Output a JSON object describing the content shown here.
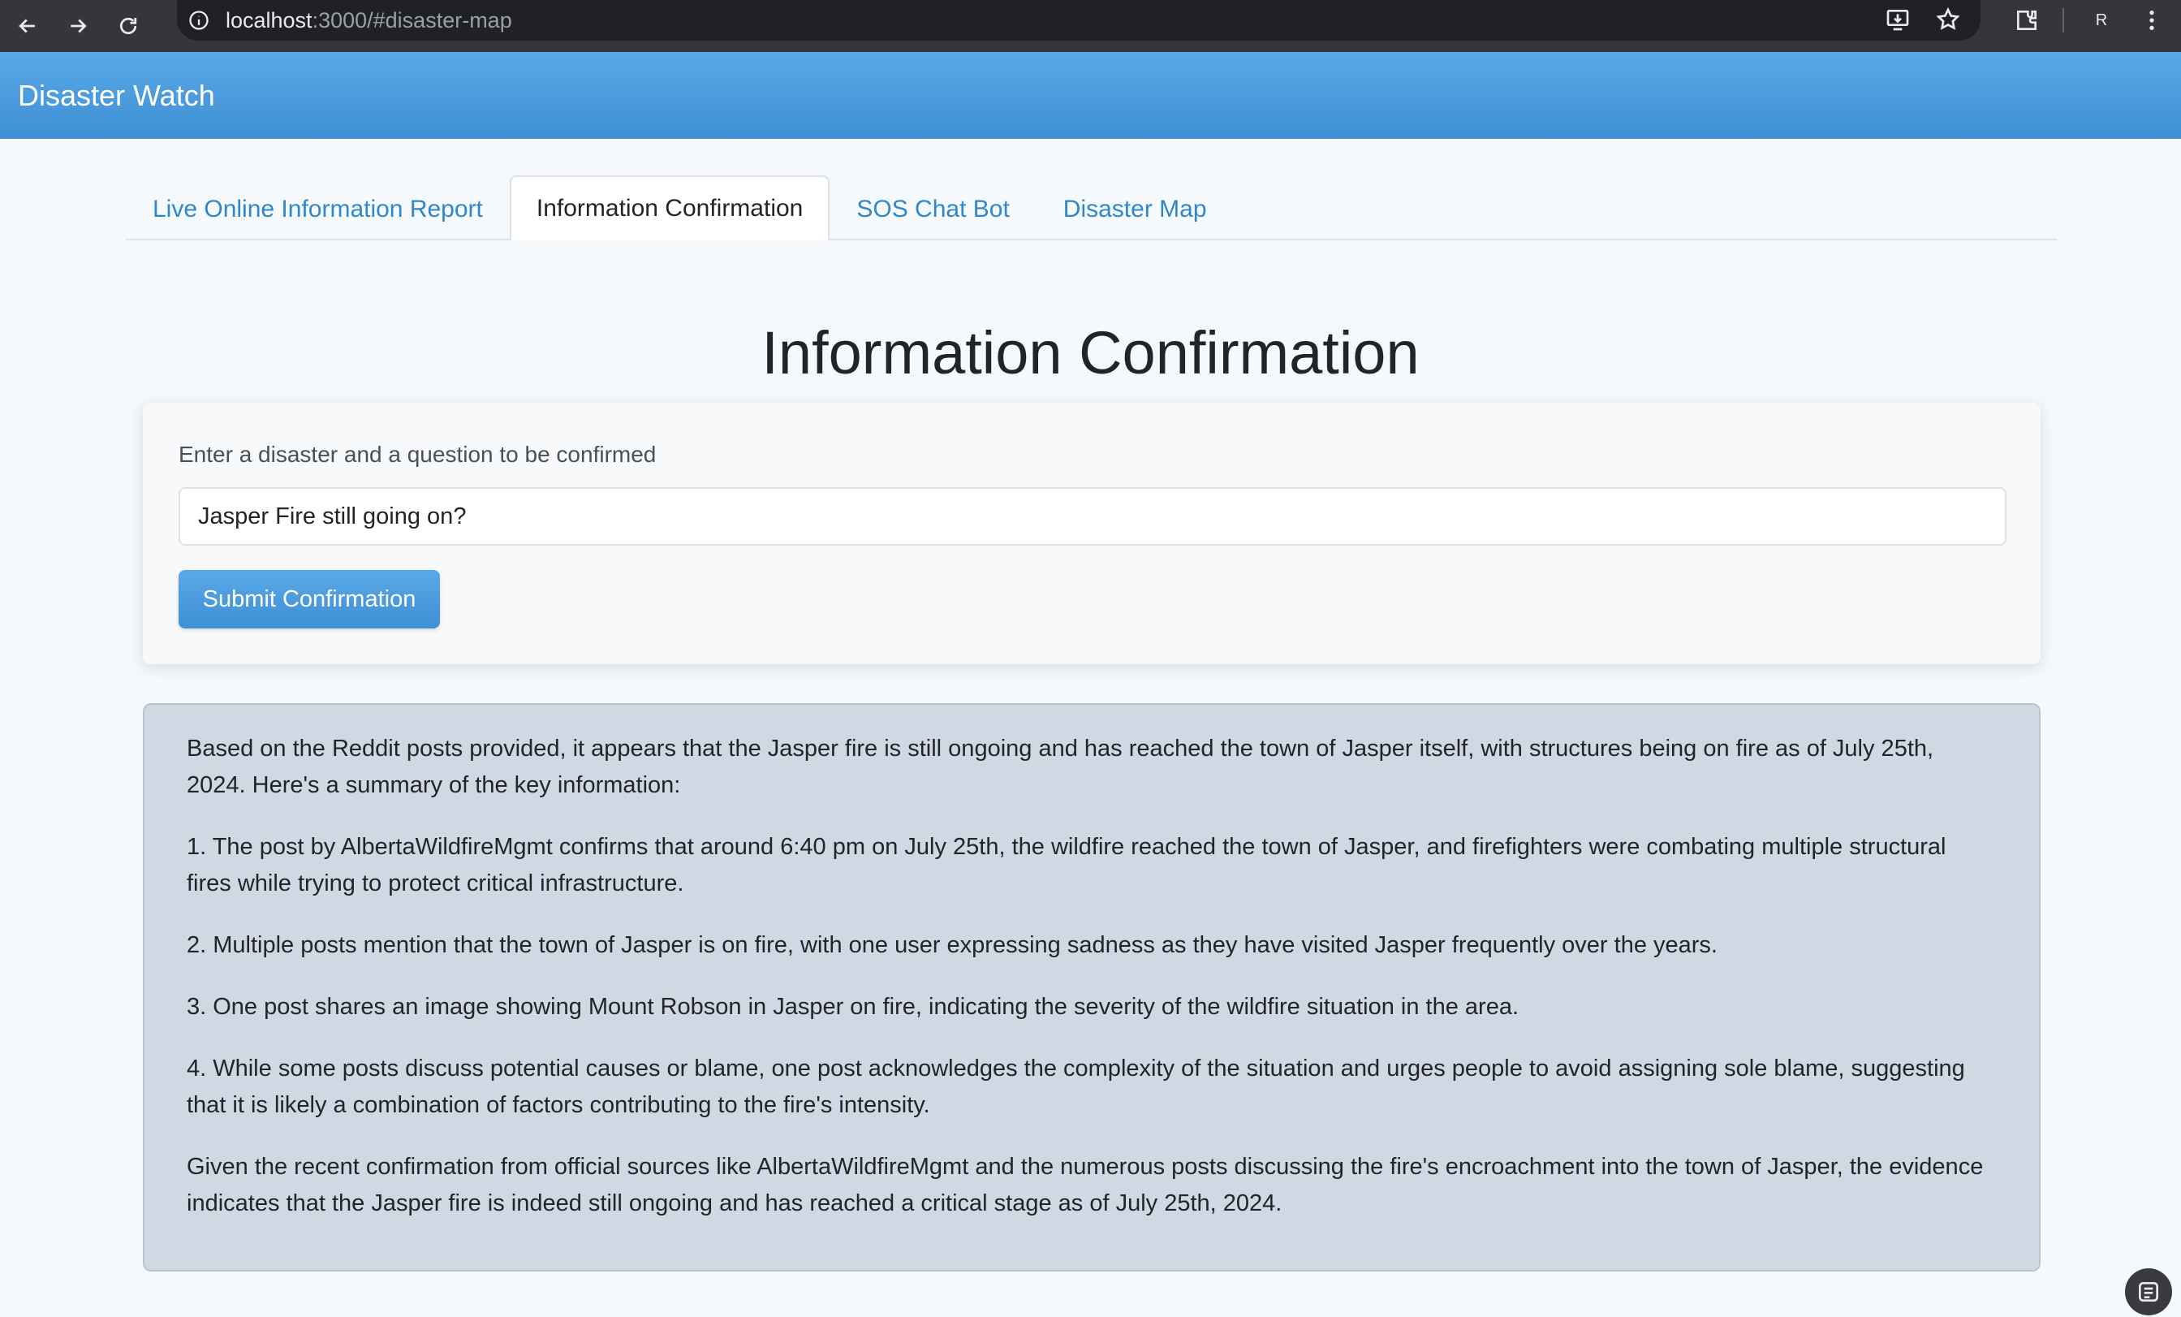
{
  "browser": {
    "url_host": "localhost",
    "url_path": ":3000/#disaster-map",
    "profile_initial": "R"
  },
  "app": {
    "brand": "Disaster Watch"
  },
  "tabs": [
    {
      "label": "Live Online Information Report",
      "active": false
    },
    {
      "label": "Information Confirmation",
      "active": true
    },
    {
      "label": "SOS Chat Bot",
      "active": false
    },
    {
      "label": "Disaster Map",
      "active": false
    }
  ],
  "page": {
    "title": "Information Confirmation"
  },
  "form": {
    "label": "Enter a disaster and a question to be confirmed",
    "input_value": "Jasper Fire still going on?",
    "submit_label": "Submit Confirmation"
  },
  "result": {
    "paragraphs": [
      "Based on the Reddit posts provided, it appears that the Jasper fire is still ongoing and has reached the town of Jasper itself, with structures being on fire as of July 25th, 2024. Here's a summary of the key information:",
      "1. The post by AlbertaWildfireMgmt confirms that around 6:40 pm on July 25th, the wildfire reached the town of Jasper, and firefighters were combating multiple structural fires while trying to protect critical infrastructure.",
      "2. Multiple posts mention that the town of Jasper is on fire, with one user expressing sadness as they have visited Jasper frequently over the years.",
      "3. One post shares an image showing Mount Robson in Jasper on fire, indicating the severity of the wildfire situation in the area.",
      "4. While some posts discuss potential causes or blame, one post acknowledges the complexity of the situation and urges people to avoid assigning sole blame, suggesting that it is likely a combination of factors contributing to the fire's intensity.",
      "Given the recent confirmation from official sources like AlbertaWildfireMgmt and the numerous posts discussing the fire's encroachment into the town of Jasper, the evidence indicates that the Jasper fire is indeed still ongoing and has reached a critical stage as of July 25th, 2024."
    ]
  },
  "colors": {
    "header_blue": "#4a9bdc",
    "tab_link": "#2f87cc",
    "result_bg": "#cfd8e3"
  },
  "icons": [
    "back-icon",
    "forward-icon",
    "reload-icon",
    "info-icon",
    "install-icon",
    "star-icon",
    "extensions-icon",
    "menu-icon",
    "screenshot-icon"
  ]
}
